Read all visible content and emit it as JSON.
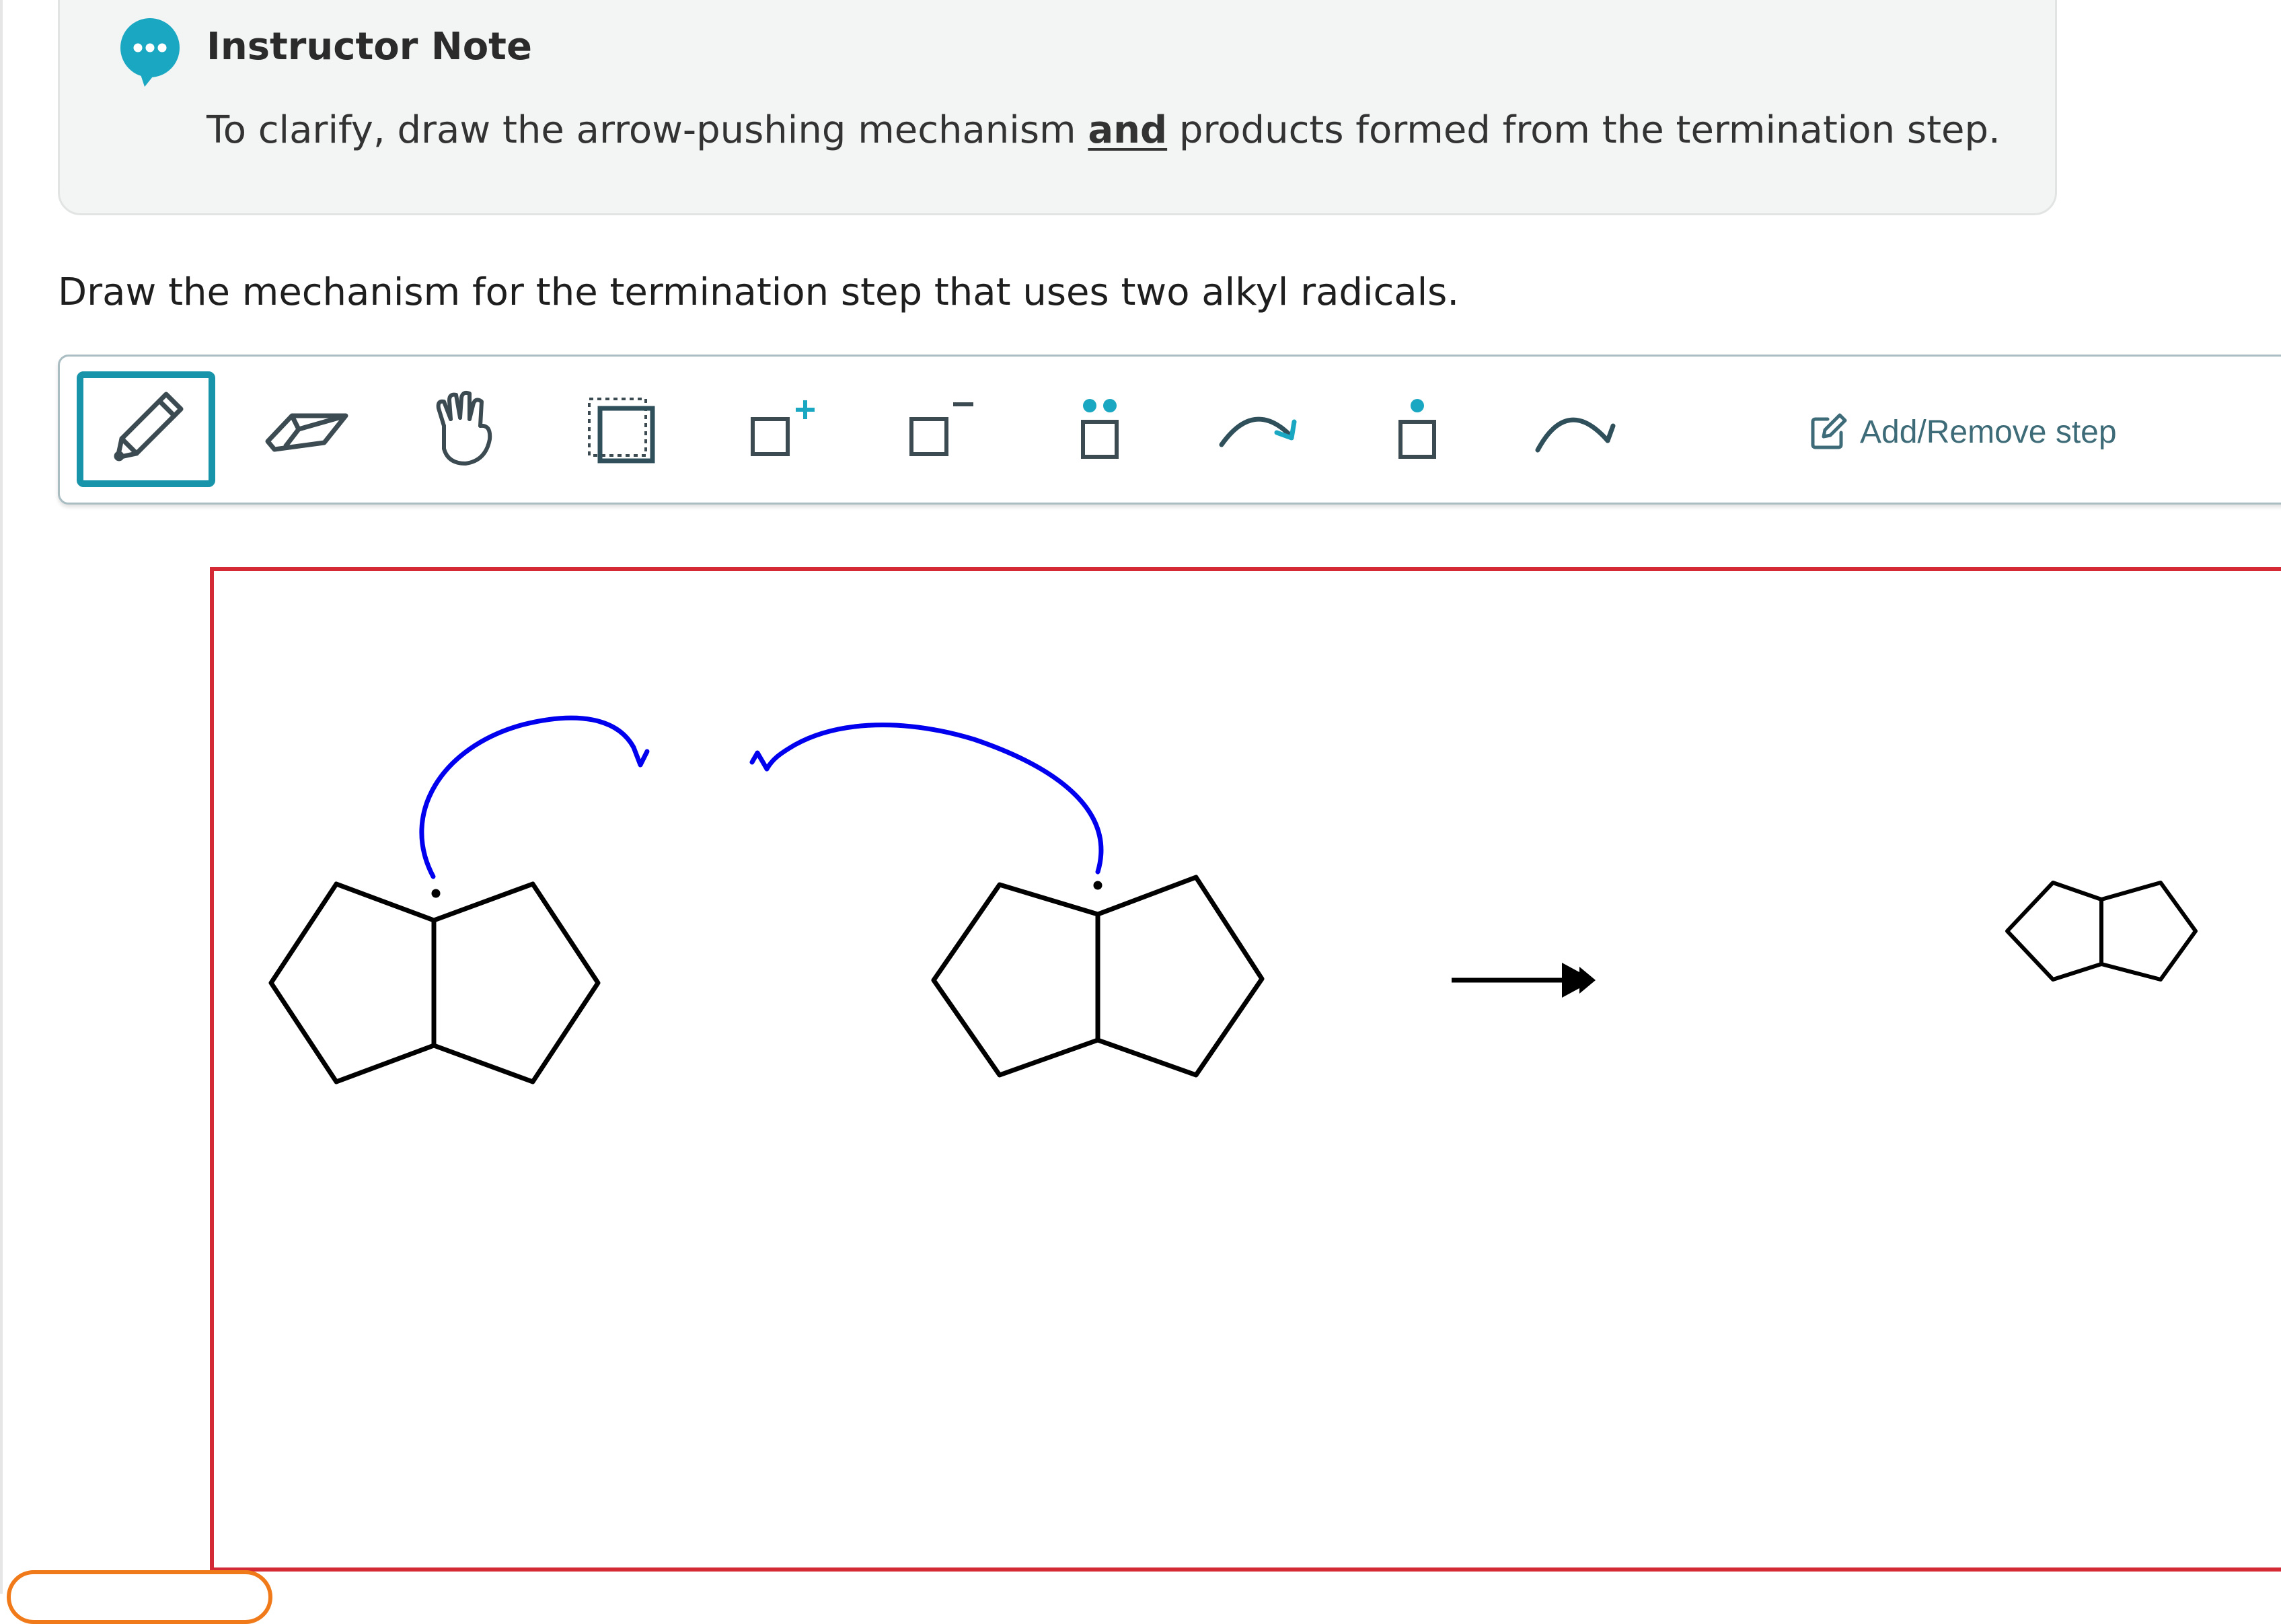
{
  "note": {
    "title": "Instructor Note",
    "body_before": "To clarify, draw the arrow-pushing mechanism ",
    "body_emphasis": "and",
    "body_after": " products formed from the termination step.",
    "accent_color": "#1aa7c2"
  },
  "prompt": "Draw the mechanism for the termination step that uses two alkyl radicals.",
  "toolbar": {
    "tools": [
      {
        "name": "pencil-tool",
        "icon": "pencil-icon",
        "selected": true
      },
      {
        "name": "eraser-tool",
        "icon": "eraser-icon"
      },
      {
        "name": "hand-tool",
        "icon": "hand-icon"
      },
      {
        "name": "select-tool",
        "icon": "marquee-select-icon"
      },
      {
        "name": "positive-charge-tool",
        "icon": "positive-charge-icon"
      },
      {
        "name": "negative-charge-tool",
        "icon": "negative-charge-icon"
      },
      {
        "name": "lone-pair-tool",
        "icon": "lone-pair-icon"
      },
      {
        "name": "full-arrow-tool",
        "icon": "curved-arrow-icon"
      },
      {
        "name": "radical-tool",
        "icon": "radical-dot-icon"
      },
      {
        "name": "half-arrow-tool",
        "icon": "fishhook-arrow-icon"
      }
    ],
    "add_remove_step_label": "Add/Remove step",
    "accent_color": "#1793aa"
  },
  "canvas": {
    "border_color": "#d42a35",
    "arrow_color": "#0000ee",
    "contents": [
      "bicyclic-radical-left",
      "bicyclic-radical-right",
      "reaction-arrow",
      "product-structure"
    ]
  }
}
